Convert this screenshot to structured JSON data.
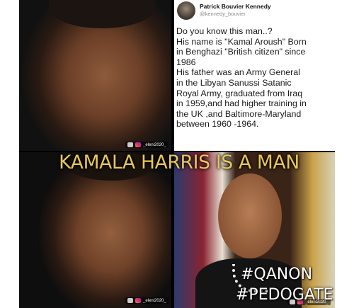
{
  "tweet": {
    "author_name": "Patrick Bouvier Kennedy",
    "author_handle": "@kennedy_bouvier",
    "lines": [
      "Do you know this man..?",
      "His name is \"Kamal Aroush\" Born",
      "in Benghazi \"British citizen\" since",
      "1986",
      "His father was an Army General",
      "in the Libyan Sanussi Satanic",
      "Royal Army, graduated from Iraq",
      "in 1959,and had higher training in",
      "the UK ,and Baltimore-Maryland",
      "between 1960 -1964."
    ]
  },
  "overlay": {
    "headline": "KAMALA HARRIS IS A MAN",
    "hashtag_1": "#QANON",
    "hashtag_2": "#PEDOGATE",
    "headline_color": "#e9c75a"
  },
  "watermarks": {
    "top_left": "_eleni2020_",
    "bottom_left": "_eleni2020_",
    "bottom_right": "_eleni2020_"
  }
}
